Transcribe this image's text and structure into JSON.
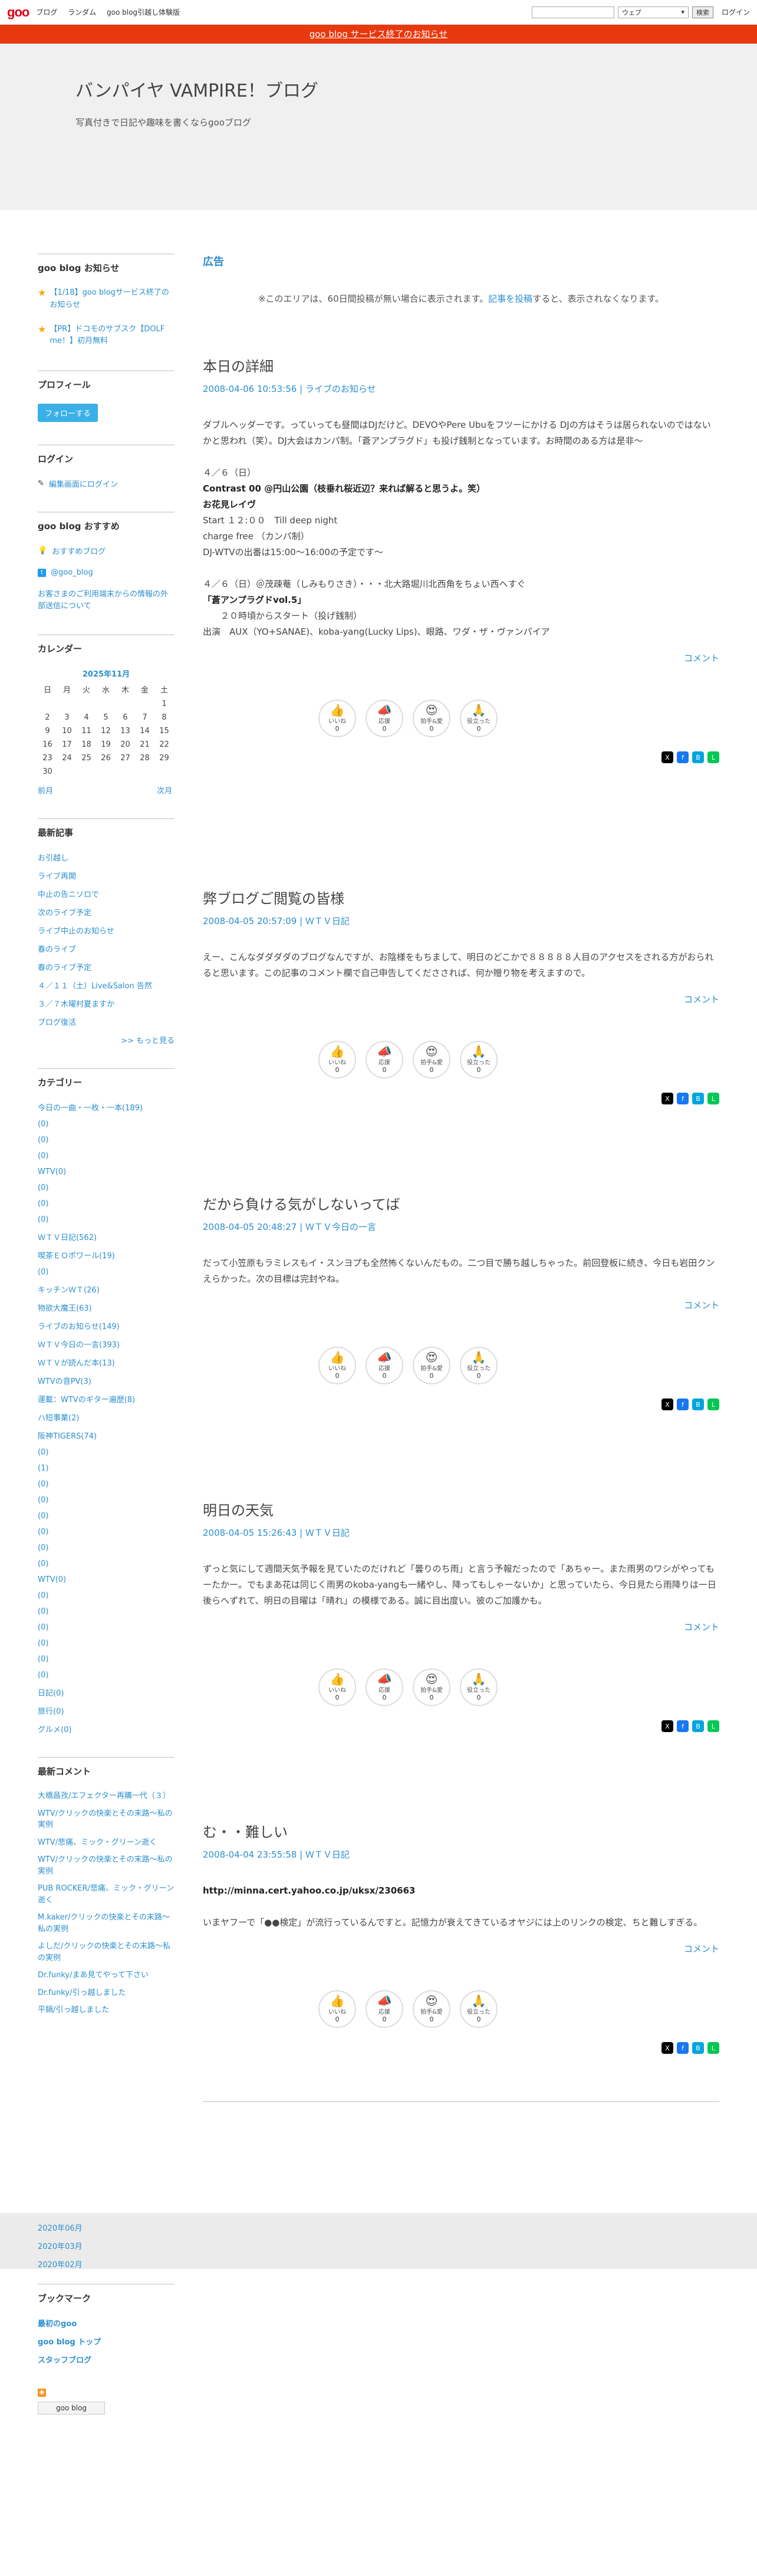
{
  "header": {
    "logo": "goo",
    "nav": [
      "ブログ",
      "ランダム",
      "goo blog引越し体験版"
    ],
    "search_placeholder": "",
    "search_scope": "ウェブ",
    "search_button": "検索",
    "login": "ログイン"
  },
  "notice": "goo blog サービス終了のお知らせ",
  "blog": {
    "title": "バンパイヤ VAMPIRE！ブログ",
    "description": "写真付きで日記や趣味を書くならgooブログ"
  },
  "sidebar": {
    "news": {
      "heading": "goo blog お知らせ",
      "items": [
        "【1/18】goo blogサービス終了のお知らせ",
        "【PR】ドコモのサブスク【DOLF me！】初月無料"
      ]
    },
    "profile": {
      "heading": "プロフィール",
      "follow": "フォローする"
    },
    "login": {
      "heading": "ログイン",
      "link": "編集画面にログイン"
    },
    "recommend": {
      "heading": "goo blog おすすめ",
      "items": [
        "おすすめブログ",
        "@goo_blog",
        "お客さまのご利用端末からの情報の外部送信について"
      ]
    },
    "calendar": {
      "heading": "カレンダー",
      "month": "2025年11月",
      "weekdays": [
        "日",
        "月",
        "火",
        "水",
        "木",
        "金",
        "土"
      ],
      "days": [
        "",
        "",
        "",
        "",
        "",
        "",
        "1",
        "2",
        "3",
        "4",
        "5",
        "6",
        "7",
        "8",
        "9",
        "10",
        "11",
        "12",
        "13",
        "14",
        "15",
        "16",
        "17",
        "18",
        "19",
        "20",
        "21",
        "22",
        "23",
        "24",
        "25",
        "26",
        "27",
        "28",
        "29",
        "30"
      ],
      "prev": "前月",
      "next": "次月"
    },
    "recent": {
      "heading": "最新記事",
      "items": [
        "お引越し",
        "ライブ再開",
        "中止の告ニソロで",
        "次のライブ予定",
        "ライブ中止のお知らせ",
        "春のライブ",
        "春のライブ予定",
        "４／１１（土）Live&Salon 告然",
        "３／７木曜村夏ますか",
        "ブログ復活"
      ],
      "more": ">> もっと見る"
    },
    "categories": {
      "heading": "カテゴリー",
      "items": [
        "今日の一曲・一枚・一本(189)",
        "(0)",
        "(0)",
        "(0)",
        "WTV(0)",
        "(0)",
        "(0)",
        "(0)",
        "ＷＴＶ日記(562)",
        "喫茶ＥＯポワール(19)",
        "(0)",
        "キッチンＷＴ(26)",
        "物欲大魔王(63)",
        "ライブのお知らせ(149)",
        "ＷＴＶ今日の一言(393)",
        "ＷＴＶが読んだ本(13)",
        "WTVの音PV(3)",
        "運載：WTVのギター遍歴(8)",
        "ハ短事業(2)",
        "阪神TIGERS(74)",
        "(0)",
        "(1)",
        "(0)",
        "(0)",
        "(0)",
        "(0)",
        "(0)",
        "(0)",
        "WTV(0)",
        "(0)",
        "(0)",
        "(0)",
        "(0)",
        "(0)",
        "(0)",
        "日記(0)",
        "旅行(0)",
        "グルメ(0)"
      ]
    },
    "comments": {
      "heading": "最新コメント",
      "items": [
        "大橋昌孜/エフェクター再購一代（３）",
        "WTV/クリックの快楽とその末路～私の実例",
        "WTV/悲痛、ミック・グリーン逝く",
        "WTV/クリックの快楽とその末路～私の実例",
        "PUB ROCKER/悲痛、ミック・グリーン逝く",
        "M.kaker/クリックの快楽とその末路～私の実例",
        "よしだ/クリックの快楽とその末路～私の実例",
        "Dr.funky/まあ見てやって下さい",
        "Dr.funky/引っ越しました",
        "平鍋/引っ越しました"
      ]
    },
    "archive": [
      "2020年06月",
      "2020年03月",
      "2020年02月"
    ],
    "bookmarks": {
      "heading": "ブックマーク",
      "items": [
        "最初のgoo",
        "goo blog トップ",
        "スタッフブログ"
      ]
    },
    "footer_logo": "goo blog"
  },
  "ad": {
    "heading": "広告",
    "note_pre": "※このエリアは、60日間投稿が無い場合に表示されます。",
    "note_link": "記事を投稿",
    "note_post": "すると、表示されなくなります。"
  },
  "reaction_labels": [
    "いいね",
    "応援",
    "拍手&愛",
    "役立った"
  ],
  "comment_label": "コメント",
  "posts": [
    {
      "title": "本日の詳細",
      "date": "2008-04-06 10:53:56",
      "category": "ライブのお知らせ",
      "lines": [
        "ダブルヘッダーです。っていっても昼間はDJだけど。DEVOやPere Ubuをフツーにかける DJの方はそうは居られないのではないかと思われ（笑）。DJ大会はカンパ制。「蒼アンプラグド」も投げ銭制となっています。お時間のある方は是非～",
        "",
        "４／６（日）",
        "Contrast 00 @円山公園（枝垂れ桜近辺？来れば解ると思うよ。笑）",
        "お花見レイヴ",
        "Start １２:００　Till deep night",
        "charge free （カンパ制）",
        "DJ-WTVの出番は15:00〜16:00の予定です〜",
        "",
        "４／６（日）＠茂疎菴（しみもりさき）・・・北大路堀川北西角をちょい西へすぐ",
        "「蒼アンプラグドvol.5」",
        "　　２０時頃からスタート（投げ銭制）",
        "出演　AUX（YO+SANAE)、koba-yang(Lucky Lips)、眼路、ワダ・ザ・ヴァンパイア"
      ],
      "bold_lines": [
        3,
        4,
        10
      ],
      "counts": [
        "0",
        "0",
        "0",
        "0"
      ]
    },
    {
      "title": "弊ブログご閲覧の皆様",
      "date": "2008-04-05 20:57:09",
      "category": "ＷＴＶ日記",
      "lines": [
        "えー、こんなダダダダのブログなんですが、お陰様をもちまして、明日のどこかで８８８８８人目のアクセスをされる方がおられると思います。この記事のコメント欄で自己申告してくださされば、何か贈り物を考えますので。"
      ],
      "bold_lines": [],
      "counts": [
        "0",
        "0",
        "0",
        "0"
      ]
    },
    {
      "title": "だから負ける気がしないってば",
      "date": "2008-04-05 20:48:27",
      "category": "ＷＴＶ今日の一言",
      "lines": [
        "だって小笠原もラミレスもイ・スンヨプも全然怖くないんだもの。二つ目で勝ち越しちゃった。前回登板に続き、今日も岩田クンえらかった。次の目標は完封やね。"
      ],
      "bold_lines": [],
      "counts": [
        "0",
        "0",
        "0",
        "0"
      ]
    },
    {
      "title": "明日の天気",
      "date": "2008-04-05 15:26:43",
      "category": "ＷＴＶ日記",
      "lines": [
        "ずっと気にして週間天気予報を見ていたのだけれど「曇りのち雨」と言う予報だったので「あちゃー。また雨男のワシがやってもーたかー。でもまあ花は同じく雨男のkoba-yangも一緒やし、降ってもしゃーないか」と思っていたら、今日見たら雨降りは一日後らへずれて、明日の目曜は「晴れ」の模様である。誠に目出度い。彼のご加護かも。"
      ],
      "bold_lines": [],
      "counts": [
        "0",
        "0",
        "0",
        "0"
      ]
    },
    {
      "title": "む・・難しい",
      "date": "2008-04-04 23:55:58",
      "category": "ＷＴＶ日記",
      "lines": [
        "http://minna.cert.yahoo.co.jp/uksx/230663",
        "",
        "いまヤフーで「●●検定」が流行っているんですと。記憶力が衰えてきているオヤジには上のリンクの検定、ちと難しすぎる。"
      ],
      "bold_lines": [
        0
      ],
      "counts": [
        "0",
        "0",
        "0",
        "0"
      ]
    }
  ],
  "colors": {
    "accent": "#2b8fd0",
    "notice": "#e8380d",
    "logo": "#e60012"
  }
}
